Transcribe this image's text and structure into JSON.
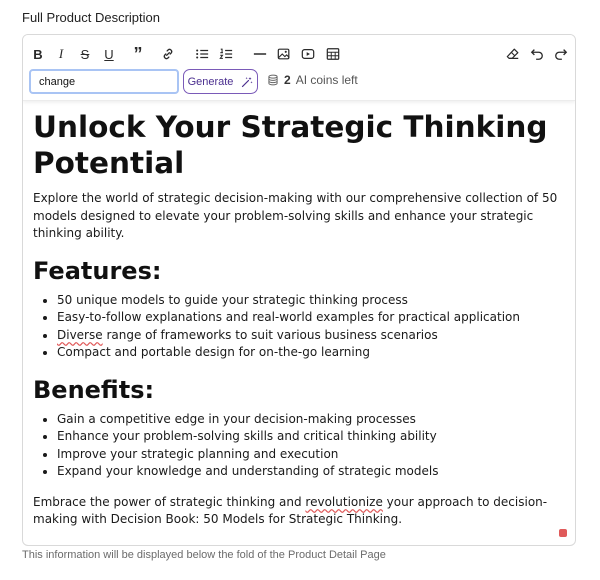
{
  "field": {
    "label": "Full Product Description",
    "help_text": "This information will be displayed below the fold of the Product Detail Page"
  },
  "toolbar": {
    "tools": [
      "bold",
      "italic",
      "strikethrough",
      "underline",
      "quote",
      "link",
      "bullet-list",
      "numbered-list",
      "horizontal-rule",
      "image",
      "video",
      "table",
      "clear-format",
      "undo",
      "redo"
    ],
    "bold_glyph": "B",
    "italic_glyph": "I",
    "strike_glyph": "S",
    "underline_glyph": "U",
    "quote_glyph": "”",
    "ai": {
      "prompt_value": "change",
      "generate_label": "Generate",
      "coins_count": "2",
      "coins_label": "AI coins left"
    }
  },
  "document": {
    "title": "Unlock Your Strategic Thinking Potential",
    "intro": "Explore the world of strategic decision-making with our comprehensive collection of 50 models designed to elevate your problem-solving skills and enhance your strategic thinking ability.",
    "features_heading": "Features:",
    "features": [
      "50 unique models to guide your strategic thinking process",
      "Easy-to-follow explanations and real-world examples for practical application",
      "Diverse range of frameworks to suit various business scenarios",
      "Compact and portable design for on-the-go learning"
    ],
    "benefits_heading": "Benefits:",
    "benefits": [
      "Gain a competitive edge in your decision-making processes",
      "Enhance your problem-solving skills and critical thinking ability",
      "Improve your strategic planning and execution",
      "Expand your knowledge and understanding of strategic models"
    ],
    "closing": "Embrace the power of strategic thinking and revolutionize your approach to decision-making with Decision Book: 50 Models for Strategic Thinking."
  },
  "colors": {
    "generate_border": "#7a5ab8",
    "input_focus": "#a9c4f4",
    "spellcheck": "#e05a5a"
  }
}
